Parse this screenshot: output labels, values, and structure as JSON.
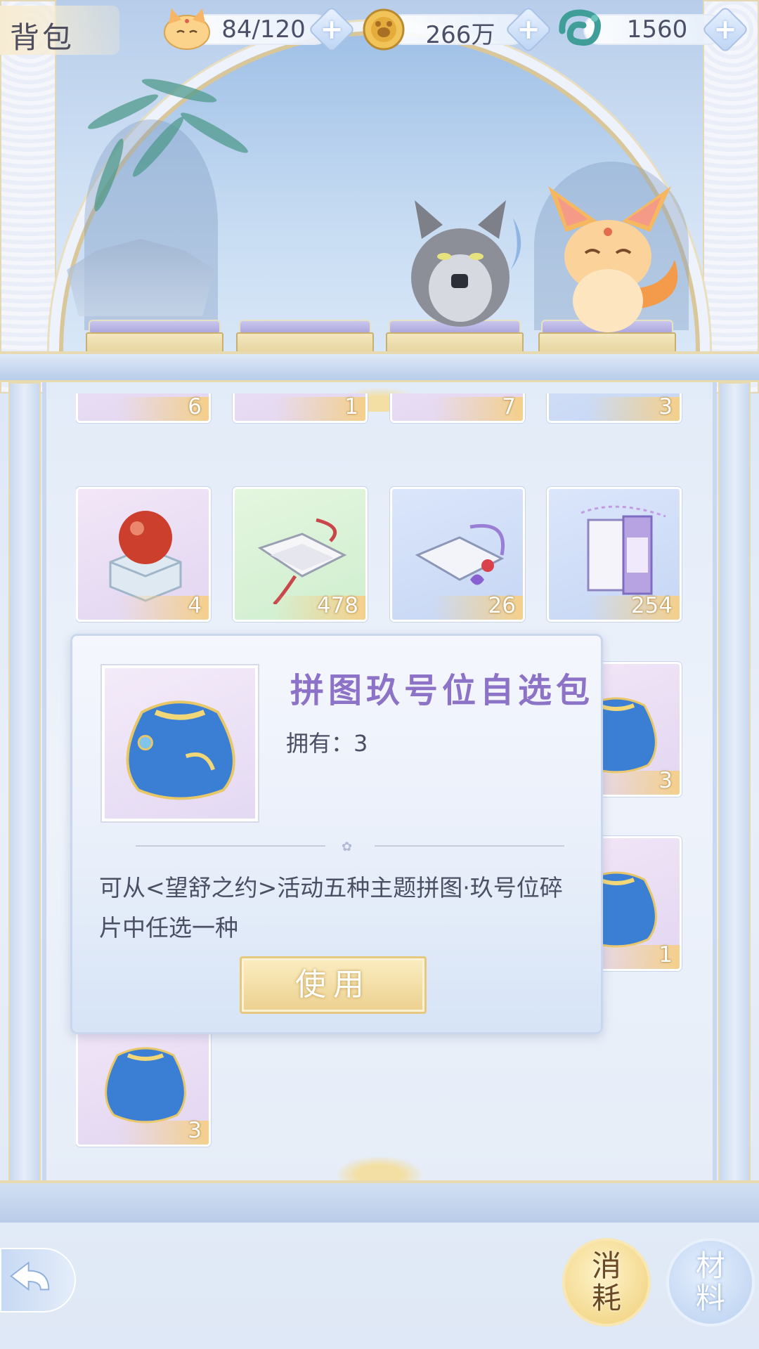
{
  "header": {
    "title": "背包",
    "resources": [
      {
        "icon": "cat-face-icon",
        "value": "84/120"
      },
      {
        "icon": "gold-coin-icon",
        "value": "266万"
      },
      {
        "icon": "jade-dragon-icon",
        "value": "1560"
      }
    ],
    "plus_symbol": "+"
  },
  "colors": {
    "accent_gold": "#ecd08e",
    "title_purple": "#8d73c7",
    "frame_blue": "#c9d8ee"
  },
  "inventory": {
    "row_partial": [
      {
        "qty": "6",
        "bg": "purple"
      },
      {
        "qty": "1",
        "bg": "purple"
      },
      {
        "qty": "7",
        "bg": "purple"
      },
      {
        "qty": "3",
        "bg": "blue"
      }
    ],
    "row_2": [
      {
        "qty": "4",
        "bg": "purple",
        "icon": "red-orb-box-icon"
      },
      {
        "qty": "478",
        "bg": "green",
        "icon": "scroll-book-icon"
      },
      {
        "qty": "26",
        "bg": "blue",
        "icon": "book-with-pendant-icon"
      },
      {
        "qty": "254",
        "bg": "blue",
        "icon": "music-score-book-icon"
      }
    ],
    "right_col": [
      {
        "qty": "3",
        "bg": "purple",
        "icon": "blue-pouch-icon"
      },
      {
        "qty": "1",
        "bg": "purple",
        "icon": "blue-pouch-icon"
      }
    ],
    "last_row": [
      {
        "qty": "3",
        "bg": "purple",
        "icon": "blue-pouch-icon"
      }
    ]
  },
  "detail": {
    "name": "拼图玖号位自选包",
    "owned": "拥有：3",
    "description": "可从<望舒之约>活动五种主题拼图·玖号位碎片中任选一种",
    "use_label": "使用"
  },
  "bottom_nav": {
    "back_icon": "back-arrow-icon",
    "tabs": [
      {
        "label_1": "消",
        "label_2": "耗",
        "active": true
      },
      {
        "label_1": "材",
        "label_2": "料",
        "active": false
      }
    ]
  }
}
